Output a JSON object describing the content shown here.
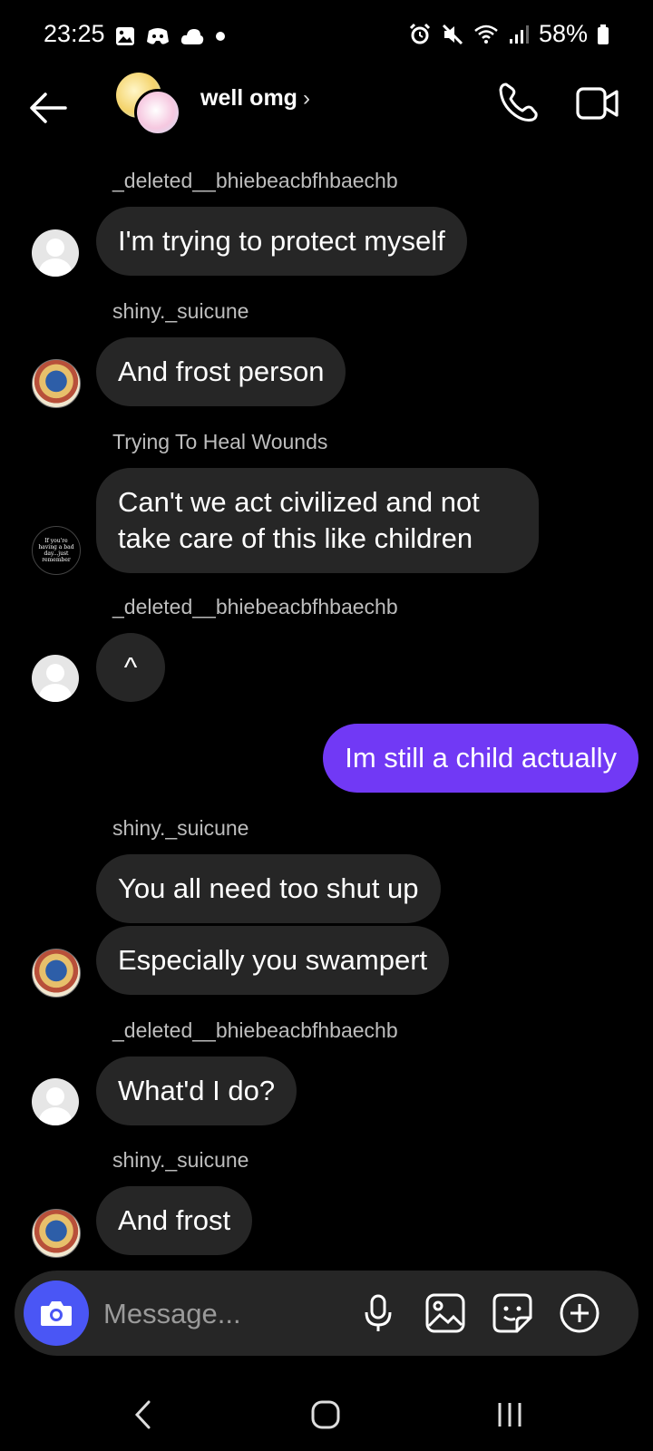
{
  "status_bar": {
    "time": "23:25",
    "battery": "58%"
  },
  "header": {
    "title": "well omg",
    "chevron": "›"
  },
  "messages": [
    {
      "sender": "_deleted__bhiebeacbfhbaechb",
      "text": "I'm trying to protect myself",
      "avatar": "default-avatar"
    },
    {
      "sender": "shiny._suicune",
      "text": "And frost person",
      "avatar": "shiny-avatar"
    },
    {
      "sender": "Trying To Heal Wounds",
      "text": "Can't we act civilized and not take care of this like children",
      "avatar": "heal-avatar",
      "avatar_text": "If you're having a bad day...just remember"
    },
    {
      "sender": "_deleted__bhiebeacbfhbaechb",
      "text": "^",
      "avatar": "default-avatar"
    },
    {
      "sender": "",
      "text": "Im still a child actually",
      "mine": true
    },
    {
      "sender": "shiny._suicune",
      "texts": [
        "You all need too shut up",
        "Especially you swampert"
      ],
      "avatar": "shiny-avatar"
    },
    {
      "sender": "_deleted__bhiebeacbfhbaechb",
      "text": "What'd I do?",
      "avatar": "default-avatar"
    },
    {
      "sender": "shiny._suicune",
      "text": "And frost",
      "avatar": "shiny-avatar"
    }
  ],
  "composer": {
    "placeholder": "Message..."
  },
  "colors": {
    "my_bubble": "#7139f5",
    "their_bubble": "#262626",
    "camera_button": "#4a56f5"
  },
  "icons": [
    "back-arrow-icon",
    "phone-icon",
    "video-camera-icon",
    "camera-icon",
    "microphone-icon",
    "gallery-icon",
    "sticker-icon",
    "plus-icon"
  ]
}
